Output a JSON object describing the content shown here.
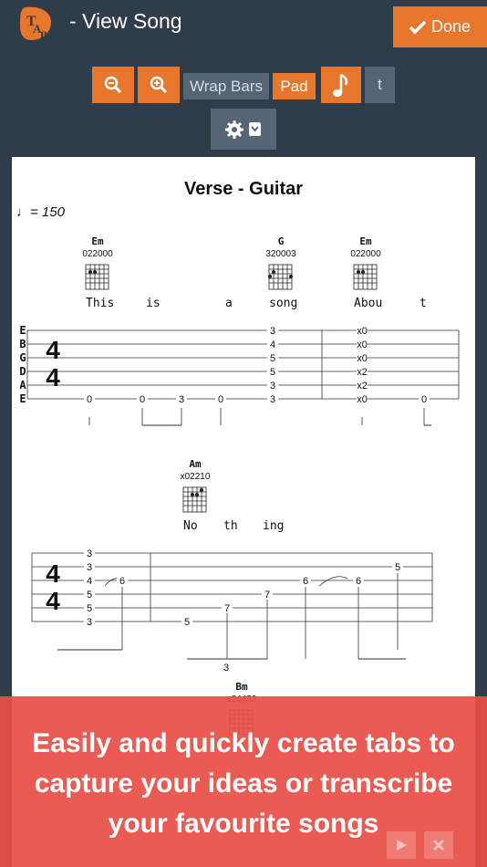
{
  "header": {
    "title": "-  View Song",
    "done_label": "Done"
  },
  "toolbar": {
    "wrap_label": "Wrap Bars",
    "pad_label": "Pad",
    "t_label": "t"
  },
  "sheet": {
    "title": "Verse - Guitar",
    "tempo": "= 150",
    "chords": [
      {
        "name": "Em",
        "fingering": "022000"
      },
      {
        "name": "G",
        "fingering": "320003"
      },
      {
        "name": "Em",
        "fingering": "022000"
      },
      {
        "name": "Am",
        "fingering": "x02210"
      },
      {
        "name": "Bm",
        "fingering": "x24432"
      }
    ],
    "lyrics1": [
      "This",
      "is",
      "a",
      "song",
      "Abou",
      "t"
    ],
    "lyrics2": [
      "No",
      "th",
      "ing"
    ],
    "strings": [
      "E",
      "B",
      "G",
      "D",
      "A",
      "E"
    ],
    "staff1": {
      "notes": [
        "0",
        "0",
        "3",
        "0",
        "3",
        "3",
        "4",
        "5",
        "5",
        "3",
        "x0",
        "x0",
        "x0",
        "x2",
        "x2",
        "x0",
        "0"
      ]
    },
    "staff2": {
      "notes": [
        "3",
        "3",
        "4",
        "6",
        "5",
        "5",
        "3",
        "5",
        "7",
        "7",
        "6",
        "6",
        "5"
      ]
    },
    "time_sig": "4"
  },
  "banner": {
    "line1": "Easily and quickly create tabs to",
    "line2": "capture your ideas or transcribe",
    "line3": "your favourite songs"
  },
  "colors": {
    "accent": "#e8772e",
    "header": "#2f3c4a",
    "banner": "#e85046"
  }
}
